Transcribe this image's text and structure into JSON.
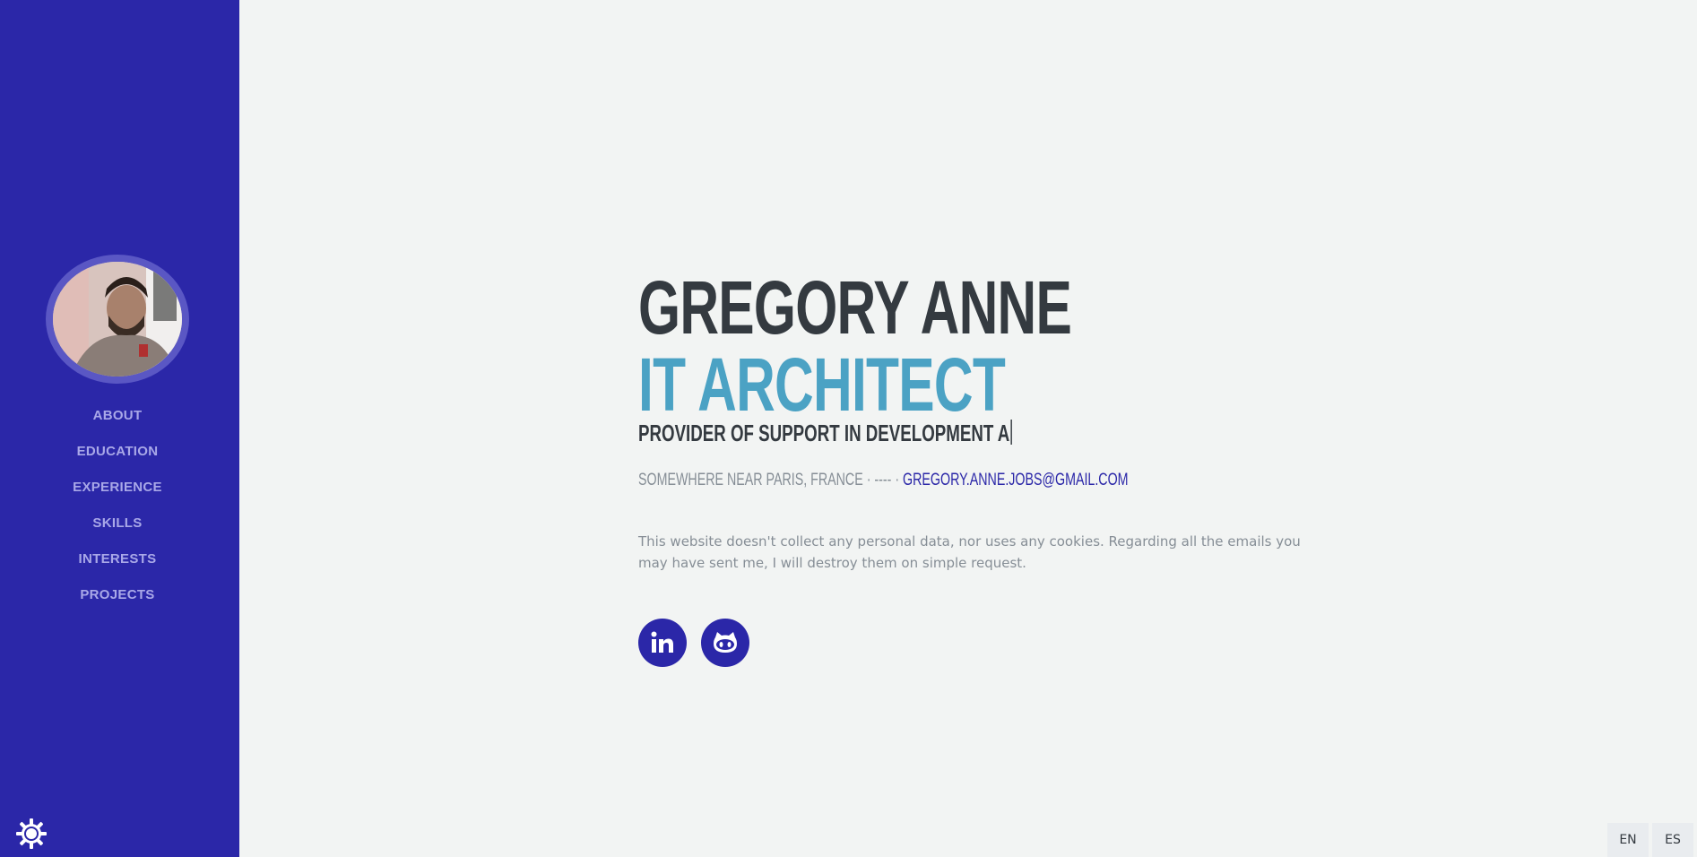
{
  "sidebar": {
    "avatar_alt": "Profile photo",
    "nav": [
      "ABOUT",
      "EDUCATION",
      "EXPERIENCE",
      "SKILLS",
      "INTERESTS",
      "PROJECTS"
    ],
    "theme_icon": "gear-sun-icon"
  },
  "hero": {
    "name": "GREGORY ANNE",
    "role": "IT ARCHITECT",
    "subtitle": "PROVIDER OF SUPPORT IN DEVELOPMENT A",
    "location": "SOMEWHERE NEAR PARIS, FRANCE",
    "separator": " · ---- · ",
    "email": "GREGORY.ANNE.JOBS@GMAIL.COM",
    "notice": "This website doesn't collect any personal data, nor uses any cookies. Regarding all the emails you may have sent me, I will destroy them on simple request."
  },
  "social": [
    {
      "name": "linkedin-icon"
    },
    {
      "name": "github-icon"
    }
  ],
  "languages": [
    "EN",
    "ES"
  ],
  "colors": {
    "sidebar": "#2b27a8",
    "accent": "#4ba2c4",
    "text": "#343a40",
    "muted": "#868e96",
    "background": "#f2f4f3"
  }
}
